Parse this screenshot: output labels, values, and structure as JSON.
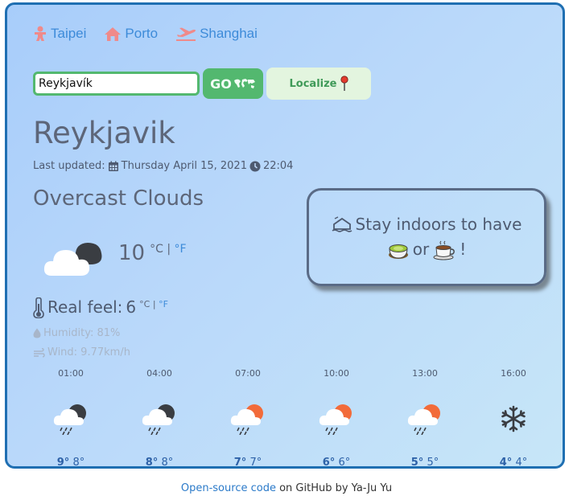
{
  "quick_cities": [
    {
      "name": "Taipei",
      "icon": "person-icon"
    },
    {
      "name": "Porto",
      "icon": "home-icon"
    },
    {
      "name": "Shanghai",
      "icon": "airplane-icon"
    }
  ],
  "search": {
    "value": "Reykjavík",
    "go_label": "GO",
    "localize_label": "Localize"
  },
  "current": {
    "city": "Reykjavik",
    "updated_label": "Last updated:",
    "date": "Thursday April 15, 2021",
    "time": "22:04",
    "description": "Overcast Clouds",
    "temperature": "10",
    "unit_c": "°C",
    "unit_sep": "|",
    "unit_f": "°F",
    "real_feel_label": "Real feel:",
    "real_feel": "6",
    "humidity": "Humidity: 81%",
    "wind": "Wind: 9.77km/h"
  },
  "advice": {
    "text1": "Stay indoors to have",
    "text_or": "or",
    "text_end": "!"
  },
  "forecast": [
    {
      "time": "01:00",
      "hi": "9°",
      "lo": "8°",
      "icon": "night-rain-icon"
    },
    {
      "time": "04:00",
      "hi": "8°",
      "lo": "8°",
      "icon": "night-rain-icon"
    },
    {
      "time": "07:00",
      "hi": "7°",
      "lo": "7°",
      "icon": "day-rain-icon"
    },
    {
      "time": "10:00",
      "hi": "6°",
      "lo": "6°",
      "icon": "day-rain-icon"
    },
    {
      "time": "13:00",
      "hi": "5°",
      "lo": "5°",
      "icon": "day-rain-icon"
    },
    {
      "time": "16:00",
      "hi": "4°",
      "lo": "4°",
      "icon": "snowflake-icon"
    }
  ],
  "footer": {
    "link_text": "Open-source code",
    "rest": " on GitHub by Ya-Ju Yu"
  }
}
